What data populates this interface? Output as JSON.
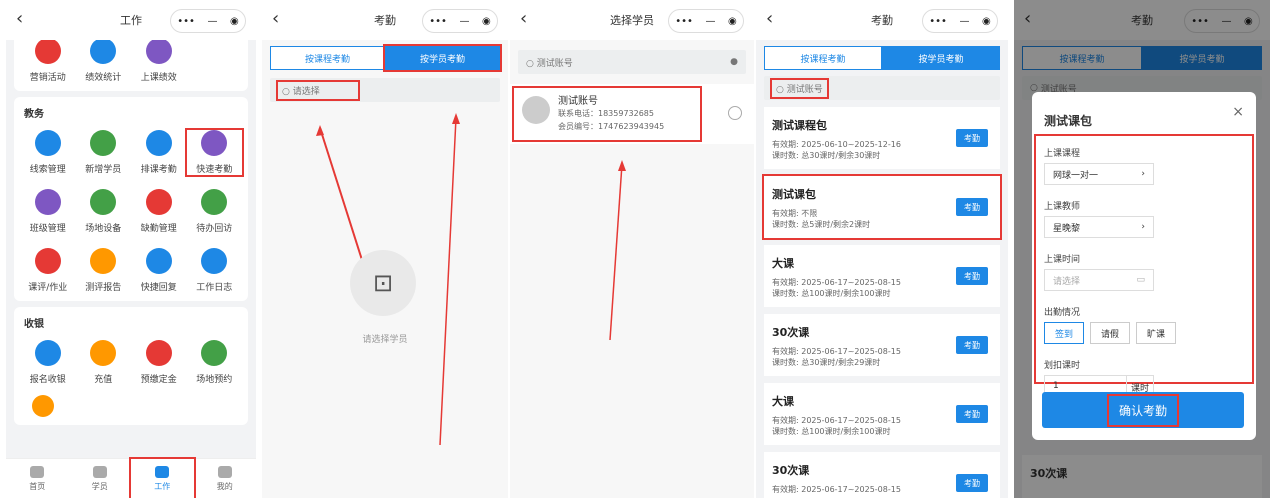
{
  "p1": {
    "title": "工作",
    "sec_jw": "教务",
    "sec_sy": "收银",
    "top": [
      "营销活动",
      "绩效统计",
      "上课绩效"
    ],
    "jw": [
      "线索管理",
      "新增学员",
      "排课考勤",
      "快速考勤",
      "班级管理",
      "场地设备",
      "缺勤管理",
      "待办回访",
      "课评/作业",
      "测评报告",
      "快捷回复",
      "工作日志"
    ],
    "sy": [
      "报名收银",
      "充值",
      "预缴定金",
      "场地预约"
    ],
    "tabs": [
      "首页",
      "学员",
      "工作",
      "我的"
    ]
  },
  "p2": {
    "title": "考勤",
    "seg_course": "按课程考勤",
    "seg_student": "按学员考勤",
    "search": "请选择",
    "empty": "请选择学员"
  },
  "p3": {
    "title": "选择学员",
    "search": "测试账号",
    "name": "测试账号",
    "phone": "联系电话：18359732685",
    "member": "会员编号：1747623943945"
  },
  "p4": {
    "title": "考勤",
    "seg_course": "按课程考勤",
    "seg_student": "按学员考勤",
    "search": "测试账号",
    "btn": "考勤",
    "cards": [
      {
        "name": "测试课程包",
        "l1": "有效期: 2025-06-10~2025-12-16",
        "l2": "课时数: 总30课时/剩余30课时"
      },
      {
        "name": "测试课包",
        "l1": "有效期: 不限",
        "l2": "课时数: 总5课时/剩余2课时"
      },
      {
        "name": "大课",
        "l1": "有效期: 2025-06-17~2025-08-15",
        "l2": "课时数: 总100课时/剩余100课时"
      },
      {
        "name": "30次课",
        "l1": "有效期: 2025-06-17~2025-08-15",
        "l2": "课时数: 总30课时/剩余29课时"
      },
      {
        "name": "大课",
        "l1": "有效期: 2025-06-17~2025-08-15",
        "l2": "课时数: 总100课时/剩余100课时"
      },
      {
        "name": "30次课",
        "l1": "有效期: 2025-06-17~2025-08-15",
        "l2": ""
      }
    ]
  },
  "p5": {
    "title": "考勤",
    "seg_course": "按课程考勤",
    "seg_student": "按学员考勤",
    "search": "测试账号",
    "modal_title": "测试课包",
    "l_course": "上课课程",
    "v_course": "网球一对一",
    "l_teacher": "上课教师",
    "v_teacher": "星晚黎",
    "l_time": "上课时间",
    "v_time": "请选择",
    "l_att": "出勤情况",
    "att": [
      "签到",
      "请假",
      "旷课"
    ],
    "l_deduct": "划扣课时",
    "v_deduct": "1",
    "unit": "课时",
    "confirm": "确认考勤",
    "under": "30次课"
  },
  "colors": {
    "blue": "#1e88e5",
    "red": "#e53935"
  }
}
